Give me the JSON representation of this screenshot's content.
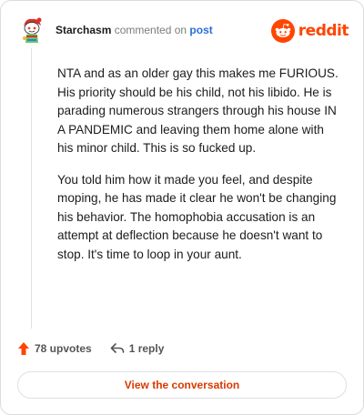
{
  "header": {
    "username": "Starchasm",
    "action_text": " commented on ",
    "post_link": "post",
    "brand_wordmark": "reddit",
    "brand_color": "#ff4500",
    "avatar_icon": "snoo-avatar-icon"
  },
  "comment": {
    "paragraphs": [
      "NTA and as an older gay this makes me FURIOUS. His priority should be his child, not his libido. He is parading numerous strangers through his house IN A PANDEMIC and leaving them home alone with his minor child. This is so fucked up.",
      "You told him how it made you feel, and despite moping, he has made it clear he won't be changing his behavior. The homophobia accusation is an attempt at deflection because he doesn't want to stop. It's time to loop in your aunt."
    ]
  },
  "actions": {
    "upvotes_label": "78 upvotes",
    "reply_label": "1 reply",
    "upvote_icon": "upvote-arrow-icon",
    "reply_icon": "reply-arrow-icon"
  },
  "footer": {
    "view_button_label": "View the conversation",
    "accent_color": "#d93a00"
  }
}
